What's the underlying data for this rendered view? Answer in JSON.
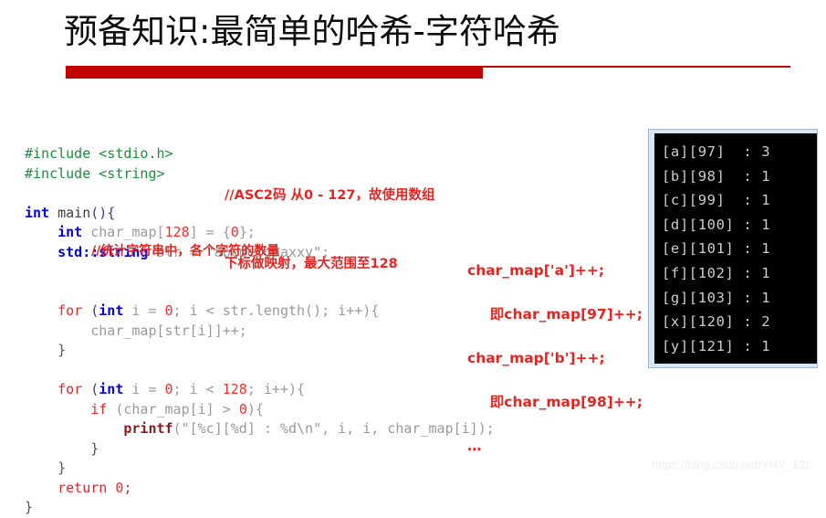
{
  "slide": {
    "title": "预备知识:最简单的哈希-字符哈希",
    "accent_color": "#c00000",
    "annotation_color": "#e8241f",
    "background_color": "#ffffff"
  },
  "code": {
    "language": "cpp",
    "lines": [
      {
        "segments": [
          {
            "t": "#include ",
            "c": "kw-green"
          },
          {
            "t": "<stdio.h>",
            "c": "kw-green"
          }
        ]
      },
      {
        "segments": [
          {
            "t": "#include ",
            "c": "kw-green"
          },
          {
            "t": "<string>",
            "c": "kw-green"
          }
        ]
      },
      {
        "segments": [
          {
            "t": "",
            "c": "plain"
          }
        ]
      },
      {
        "segments": [
          {
            "t": "int",
            "c": "kw-blue"
          },
          {
            "t": " ",
            "c": "plain"
          },
          {
            "t": "main",
            "c": "ident-dark"
          },
          {
            "t": "(){",
            "c": "punct"
          }
        ]
      },
      {
        "segments": [
          {
            "t": "    ",
            "c": "plain"
          },
          {
            "t": "int",
            "c": "kw-blue"
          },
          {
            "t": " char_map[",
            "c": "plain"
          },
          {
            "t": "128",
            "c": "num"
          },
          {
            "t": "] = {",
            "c": "plain"
          },
          {
            "t": "0",
            "c": "num"
          },
          {
            "t": "};",
            "c": "plain"
          }
        ]
      },
      {
        "segments": [
          {
            "t": "    ",
            "c": "plain"
          },
          {
            "t": "std::string",
            "c": "kw-blue"
          },
          {
            "t": " str = ",
            "c": "plain"
          },
          {
            "t": "\"abcdefgaaxxy\";",
            "c": "plain"
          }
        ]
      },
      {
        "segments": [
          {
            "t": "",
            "c": "plain"
          }
        ]
      },
      {
        "segments": [
          {
            "t": "",
            "c": "plain"
          }
        ]
      },
      {
        "segments": [
          {
            "t": "    ",
            "c": "plain"
          },
          {
            "t": "for",
            "c": "kw-red"
          },
          {
            "t": " (",
            "c": "punct"
          },
          {
            "t": "int",
            "c": "kw-blue"
          },
          {
            "t": " i = ",
            "c": "plain"
          },
          {
            "t": "0",
            "c": "num"
          },
          {
            "t": "; i < str.length(); i++){",
            "c": "plain"
          }
        ]
      },
      {
        "segments": [
          {
            "t": "        char_map[str[i]]++;",
            "c": "plain"
          }
        ]
      },
      {
        "segments": [
          {
            "t": "    }",
            "c": "brace"
          }
        ]
      },
      {
        "segments": [
          {
            "t": "",
            "c": "plain"
          }
        ]
      },
      {
        "segments": [
          {
            "t": "    ",
            "c": "plain"
          },
          {
            "t": "for",
            "c": "kw-red"
          },
          {
            "t": " (",
            "c": "punct"
          },
          {
            "t": "int",
            "c": "kw-blue"
          },
          {
            "t": " i = ",
            "c": "plain"
          },
          {
            "t": "0",
            "c": "num"
          },
          {
            "t": "; i < ",
            "c": "plain"
          },
          {
            "t": "128",
            "c": "num"
          },
          {
            "t": "; i++){",
            "c": "plain"
          }
        ]
      },
      {
        "segments": [
          {
            "t": "        ",
            "c": "plain"
          },
          {
            "t": "if",
            "c": "kw-red"
          },
          {
            "t": " (char_map[i] > ",
            "c": "plain"
          },
          {
            "t": "0",
            "c": "num"
          },
          {
            "t": "){",
            "c": "plain"
          }
        ]
      },
      {
        "segments": [
          {
            "t": "            ",
            "c": "plain"
          },
          {
            "t": "printf",
            "c": "kw-printf"
          },
          {
            "t": "(\"[%c][%d] : %d\\n\", i, i, char_map[i]);",
            "c": "plain"
          }
        ]
      },
      {
        "segments": [
          {
            "t": "        }",
            "c": "brace"
          }
        ]
      },
      {
        "segments": [
          {
            "t": "    }",
            "c": "brace"
          }
        ]
      },
      {
        "segments": [
          {
            "t": "    ",
            "c": "plain"
          },
          {
            "t": "return",
            "c": "kw-red"
          },
          {
            "t": " ",
            "c": "plain"
          },
          {
            "t": "0",
            "c": "num"
          },
          {
            "t": ";",
            "c": "kw-red"
          }
        ]
      },
      {
        "segments": [
          {
            "t": "}",
            "c": "brace"
          }
        ]
      }
    ]
  },
  "annotations": {
    "asc2_note_line1": "//ASC2码 从0 - 127，故使用数组",
    "asc2_note_line2": "下标做映射，最大范围至128",
    "count_note": "//统计字符串中，各个字符的数量",
    "char_map_example": [
      "char_map['a']++;",
      "即char_map[97]++;",
      "char_map['b']++;",
      "即char_map[98]++;",
      "…"
    ]
  },
  "console": {
    "title": "program-output",
    "background_color": "#000000",
    "text_color": "#cccccc",
    "lines": [
      "[a][97]  : 3",
      "[b][98]  : 1",
      "[c][99]  : 1",
      "[d][100] : 1",
      "[e][101] : 1",
      "[f][102] : 1",
      "[g][103] : 1",
      "[x][120] : 2",
      "[y][121] : 1"
    ]
  },
  "watermark": {
    "text": "https://blog.csdn.net/YHY_13s"
  }
}
